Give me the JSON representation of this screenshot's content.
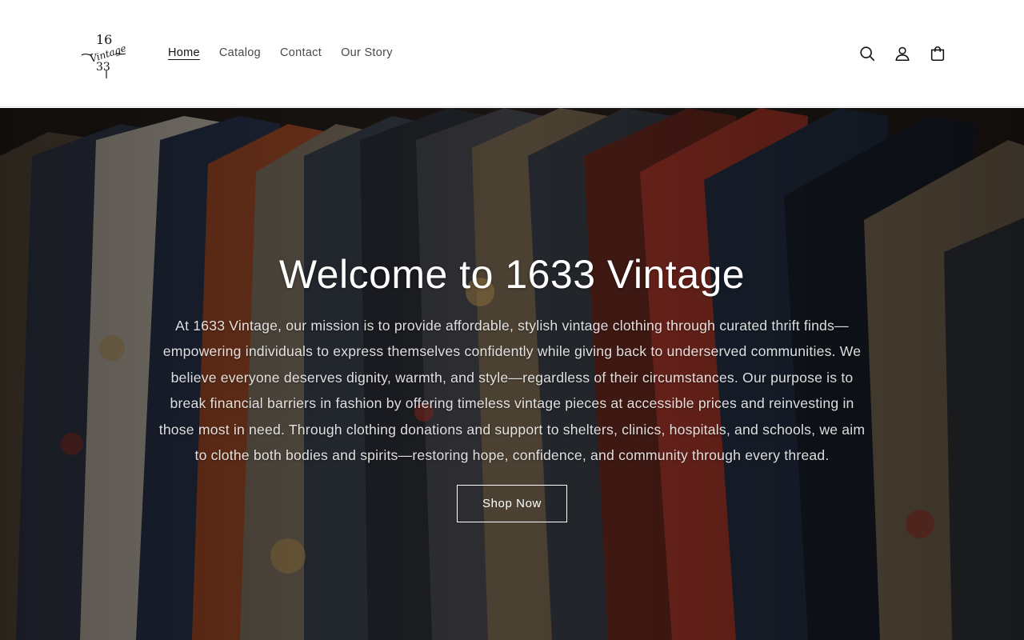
{
  "brand": {
    "name": "1633 Vintage",
    "logo_text": "16 Vintage 33"
  },
  "nav": {
    "items": [
      {
        "label": "Home",
        "active": true
      },
      {
        "label": "Catalog",
        "active": false
      },
      {
        "label": "Contact",
        "active": false
      },
      {
        "label": "Our Story",
        "active": false
      }
    ]
  },
  "header_icons": [
    "search-icon",
    "account-icon",
    "cart-icon"
  ],
  "hero": {
    "title": "Welcome to 1633 Vintage",
    "text": "At 1633 Vintage, our mission is to provide affordable, stylish vintage clothing through curated thrift finds—empowering individuals to express themselves confidently while giving back to underserved communities. We believe everyone deserves dignity, warmth, and style—regardless of their circumstances. Our purpose is to break financial barriers in fashion by offering timeless vintage pieces at accessible prices and reinvesting in those most in need. Through clothing donations and support to shelters, clinics, hospitals, and schools, we aim to clothe both bodies and spirits—restoring hope, confidence, and community through every thread.",
    "button_label": "Shop Now"
  },
  "colors": {
    "text": "#121212",
    "header_bg": "#ffffff",
    "hero_text": "#ffffff"
  }
}
